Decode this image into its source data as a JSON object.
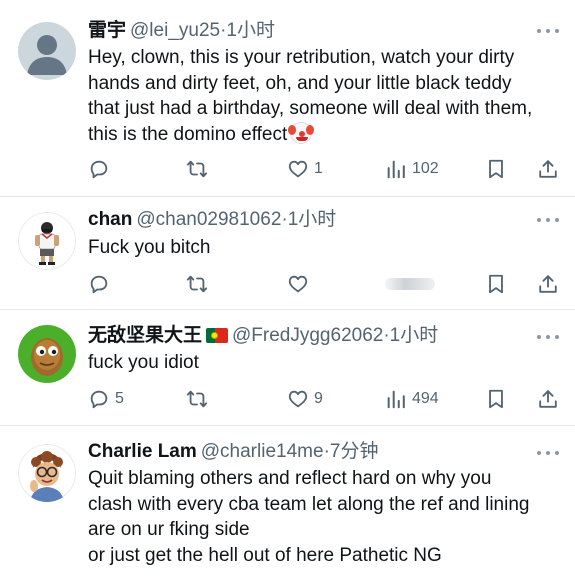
{
  "tweets": [
    {
      "name": "雷宇",
      "handle": "@lei_yu25",
      "time": "·1小时",
      "body_lines": [
        "Hey, clown, this is your retribution, watch your dirty",
        "hands and dirty feet, oh, and your little black teddy",
        "that just had a birthday, someone will deal with them,",
        "this is the domino effect"
      ],
      "emoji": "clown-face",
      "replies": "",
      "retweets": "",
      "likes": "1",
      "views": "102"
    },
    {
      "name": "chan",
      "handle": "@chan02981062",
      "time": "·1小时",
      "body_lines": [
        "Fuck you bitch"
      ],
      "replies": "",
      "retweets": "",
      "likes": "",
      "views": ""
    },
    {
      "name": "无敌坚果大王",
      "flag": "portugal-flag",
      "handle": "@FredJygg62062",
      "time": "·1小时",
      "body_lines": [
        "fuck you idiot"
      ],
      "replies": "5",
      "retweets": "",
      "likes": "9",
      "views": "494"
    },
    {
      "name": "Charlie Lam",
      "handle": "@charlie14me",
      "time": "·7分钟",
      "body_lines": [
        "Quit blaming others and reflect hard on why you",
        "clash with every cba team let along the ref and lining",
        "are on ur fking side",
        "or just get the hell out of here Pathetic NG"
      ]
    }
  ],
  "colors": {
    "text": "#0f1419",
    "secondary": "#536471",
    "divider": "#e6e9eb",
    "background": "#ffffff"
  },
  "icons": [
    "reply-icon",
    "retweet-icon",
    "like-icon",
    "views-icon",
    "bookmark-icon",
    "share-icon",
    "more-icon"
  ]
}
